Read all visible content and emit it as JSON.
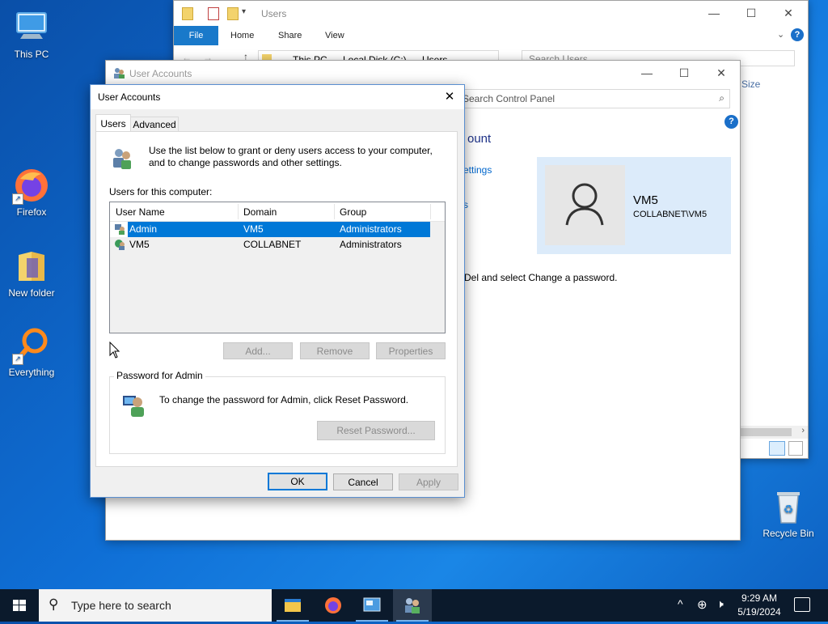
{
  "desktop": {
    "icons": [
      {
        "label": "This PC"
      },
      {
        "label": "Firefox"
      },
      {
        "label": "New folder"
      },
      {
        "label": "Everything"
      },
      {
        "label": "Recycle Bin"
      }
    ]
  },
  "explorer": {
    "title": "Users",
    "ribbon_tabs": [
      "File",
      "Home",
      "Share",
      "View"
    ],
    "breadcrumb": [
      "This PC",
      "Local Disk (C:)",
      "Users"
    ],
    "search_placeholder": "Search Users",
    "column_size": "Size",
    "help_icon": "?"
  },
  "control_panel": {
    "title": "User Accounts",
    "search_placeholder": "Search Control Panel",
    "heading_partial": "ount",
    "link_partial": "ettings",
    "link_partial2": "s",
    "instruction_partial": "Del and select Change a password.",
    "account_name": "VM5",
    "account_domain": "COLLABNET\\VM5",
    "help_icon": "?"
  },
  "dialog": {
    "title": "User Accounts",
    "tabs": [
      "Users",
      "Advanced"
    ],
    "intro": "Use the list below to grant or deny users access to your computer, and to change passwords and other settings.",
    "users_label": "Users for this computer:",
    "columns": [
      "User Name",
      "Domain",
      "Group"
    ],
    "rows": [
      {
        "name": "Admin",
        "domain": "VM5",
        "group": "Administrators"
      },
      {
        "name": "VM5",
        "domain": "COLLABNET",
        "group": "Administrators"
      }
    ],
    "buttons": {
      "add": "Add...",
      "remove": "Remove",
      "properties": "Properties"
    },
    "password_group": "Password for Admin",
    "password_text": "To change the password for Admin, click Reset Password.",
    "reset_button": "Reset Password...",
    "ok": "OK",
    "cancel": "Cancel",
    "apply": "Apply"
  },
  "taskbar": {
    "search_placeholder": "Type here to search",
    "time": "9:29 AM",
    "date": "5/19/2024"
  },
  "colors": {
    "accent": "#0078d7",
    "selection": "#0078d7",
    "taskbar": "#0b1a2c",
    "link": "#0066cc"
  }
}
